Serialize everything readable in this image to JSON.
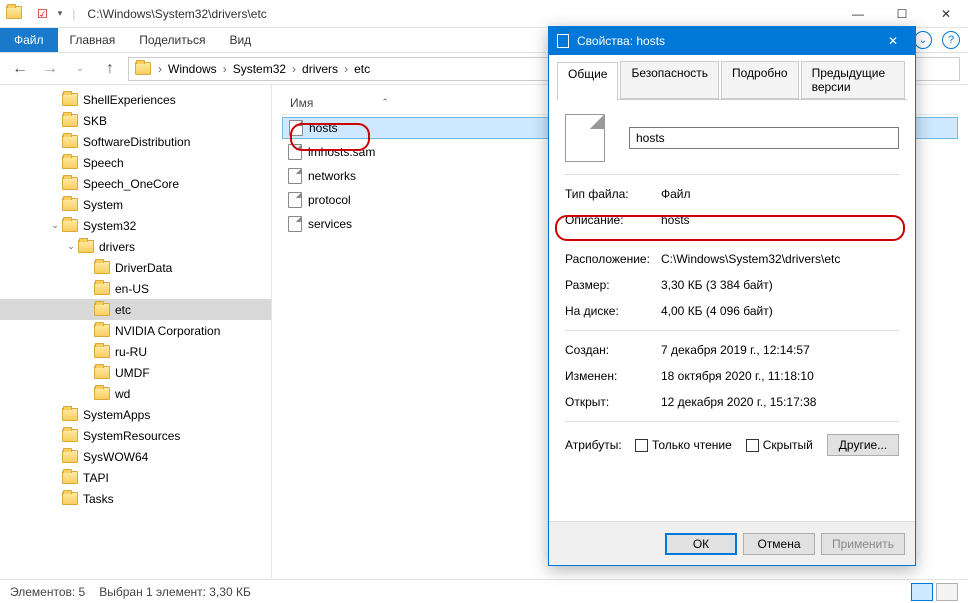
{
  "titlebar": {
    "path": "C:\\Windows\\System32\\drivers\\etc"
  },
  "ribbon": {
    "file": "Файл",
    "home": "Главная",
    "share": "Поделиться",
    "view": "Вид"
  },
  "breadcrumb": [
    "Windows",
    "System32",
    "drivers",
    "etc"
  ],
  "tree": [
    {
      "name": "ShellExperiences",
      "depth": 3
    },
    {
      "name": "SKB",
      "depth": 3
    },
    {
      "name": "SoftwareDistribution",
      "depth": 3
    },
    {
      "name": "Speech",
      "depth": 3
    },
    {
      "name": "Speech_OneCore",
      "depth": 3
    },
    {
      "name": "System",
      "depth": 3
    },
    {
      "name": "System32",
      "depth": 3,
      "expanded": true
    },
    {
      "name": "drivers",
      "depth": 4,
      "expanded": true
    },
    {
      "name": "DriverData",
      "depth": 5
    },
    {
      "name": "en-US",
      "depth": 5
    },
    {
      "name": "etc",
      "depth": 5,
      "selected": true
    },
    {
      "name": "NVIDIA Corporation",
      "depth": 5
    },
    {
      "name": "ru-RU",
      "depth": 5
    },
    {
      "name": "UMDF",
      "depth": 5
    },
    {
      "name": "wd",
      "depth": 5
    },
    {
      "name": "SystemApps",
      "depth": 3
    },
    {
      "name": "SystemResources",
      "depth": 3
    },
    {
      "name": "SysWOW64",
      "depth": 3
    },
    {
      "name": "TAPI",
      "depth": 3
    },
    {
      "name": "Tasks",
      "depth": 3
    }
  ],
  "files": {
    "header_name": "Имя",
    "items": [
      {
        "name": "hosts",
        "selected": true
      },
      {
        "name": "lmhosts.sam"
      },
      {
        "name": "networks"
      },
      {
        "name": "protocol"
      },
      {
        "name": "services"
      }
    ]
  },
  "status": {
    "count": "Элементов: 5",
    "selected": "Выбран 1 элемент: 3,30 КБ"
  },
  "dialog": {
    "title": "Свойства: hosts",
    "tabs": {
      "general": "Общие",
      "security": "Безопасность",
      "details": "Подробно",
      "previous": "Предыдущие версии"
    },
    "filename": "hosts",
    "labels": {
      "filetype": "Тип файла:",
      "filetype_v": "Файл",
      "desc": "Описание:",
      "desc_v": "hosts",
      "location": "Расположение:",
      "location_v": "C:\\Windows\\System32\\drivers\\etc",
      "size": "Размер:",
      "size_v": "3,30 КБ (3 384 байт)",
      "ondisk": "На диске:",
      "ondisk_v": "4,00 КБ (4 096 байт)",
      "created": "Создан:",
      "created_v": "7 декабря 2019 г., 12:14:57",
      "modified": "Изменен:",
      "modified_v": "18 октября 2020 г., 11:18:10",
      "accessed": "Открыт:",
      "accessed_v": "12 декабря 2020 г., 15:17:38",
      "attrs": "Атрибуты:",
      "readonly": "Только чтение",
      "hidden": "Скрытый",
      "other": "Другие..."
    },
    "buttons": {
      "ok": "ОК",
      "cancel": "Отмена",
      "apply": "Применить"
    }
  }
}
